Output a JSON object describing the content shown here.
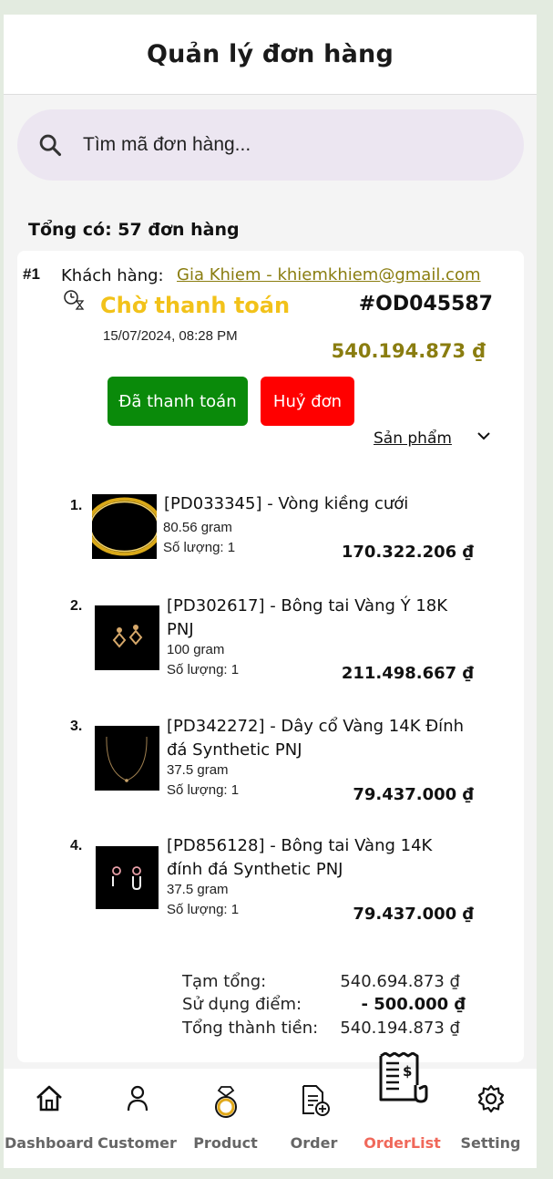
{
  "header": {
    "title": "Quản lý đơn hàng"
  },
  "search": {
    "placeholder": "Tìm mã đơn hàng..."
  },
  "summary": {
    "total_text": "Tổng có: 57 đơn hàng"
  },
  "order": {
    "index": "#1",
    "customer_label": "Khách hàng:",
    "customer_value": "Gia Khiem - khiemkhiem@gmail.com",
    "status": "Chờ thanh toán",
    "status_color": "#f2c21a",
    "code": "#OD045587",
    "datetime": "15/07/2024, 08:28 PM",
    "amount": "540.194.873 ₫",
    "paid_button": "Đã thanh toán",
    "cancel_button": "Huỷ đơn",
    "products_toggle": "Sản phẩm",
    "items": [
      {
        "num": "1.",
        "name": "[PD033345] - Vòng kiềng cưới",
        "weight": "80.56 gram",
        "qty": "Số lượng: 1",
        "price": "170.322.206 ₫",
        "image": "bangle-image"
      },
      {
        "num": "2.",
        "name": "[PD302617] - Bông tai Vàng Ý 18K PNJ",
        "weight": "100 gram",
        "qty": "Số lượng: 1",
        "price": "211.498.667 ₫",
        "image": "earring-image"
      },
      {
        "num": "3.",
        "name": "[PD342272] - Dây cổ Vàng 14K Đính đá Synthetic PNJ",
        "weight": "37.5 gram",
        "qty": "Số lượng: 1",
        "price": "79.437.000 ₫",
        "image": "necklace-image"
      },
      {
        "num": "4.",
        "name": "[PD856128] - Bông tai Vàng 14K đính đá Synthetic PNJ",
        "weight": "37.5 gram",
        "qty": "Số lượng: 1",
        "price": "79.437.000 ₫",
        "image": "earring-image"
      }
    ],
    "totals": {
      "subtotal_label": "Tạm tổng:",
      "subtotal_value": "540.694.873 ₫",
      "points_label": "Sử dụng điểm:",
      "points_value": "- 500.000 ₫",
      "grand_label": "Tổng thành tiền:",
      "grand_value": "540.194.873 ₫"
    }
  },
  "nav": {
    "items": [
      {
        "label": "Dashboard",
        "icon": "home-icon"
      },
      {
        "label": "Customer",
        "icon": "user-icon"
      },
      {
        "label": "Product",
        "icon": "ring-icon"
      },
      {
        "label": "Order",
        "icon": "order-document-icon"
      },
      {
        "label": "OrderList",
        "icon": "receipt-icon",
        "active": true
      },
      {
        "label": "Setting",
        "icon": "gear-icon"
      }
    ],
    "active_color": "#f0685a"
  }
}
